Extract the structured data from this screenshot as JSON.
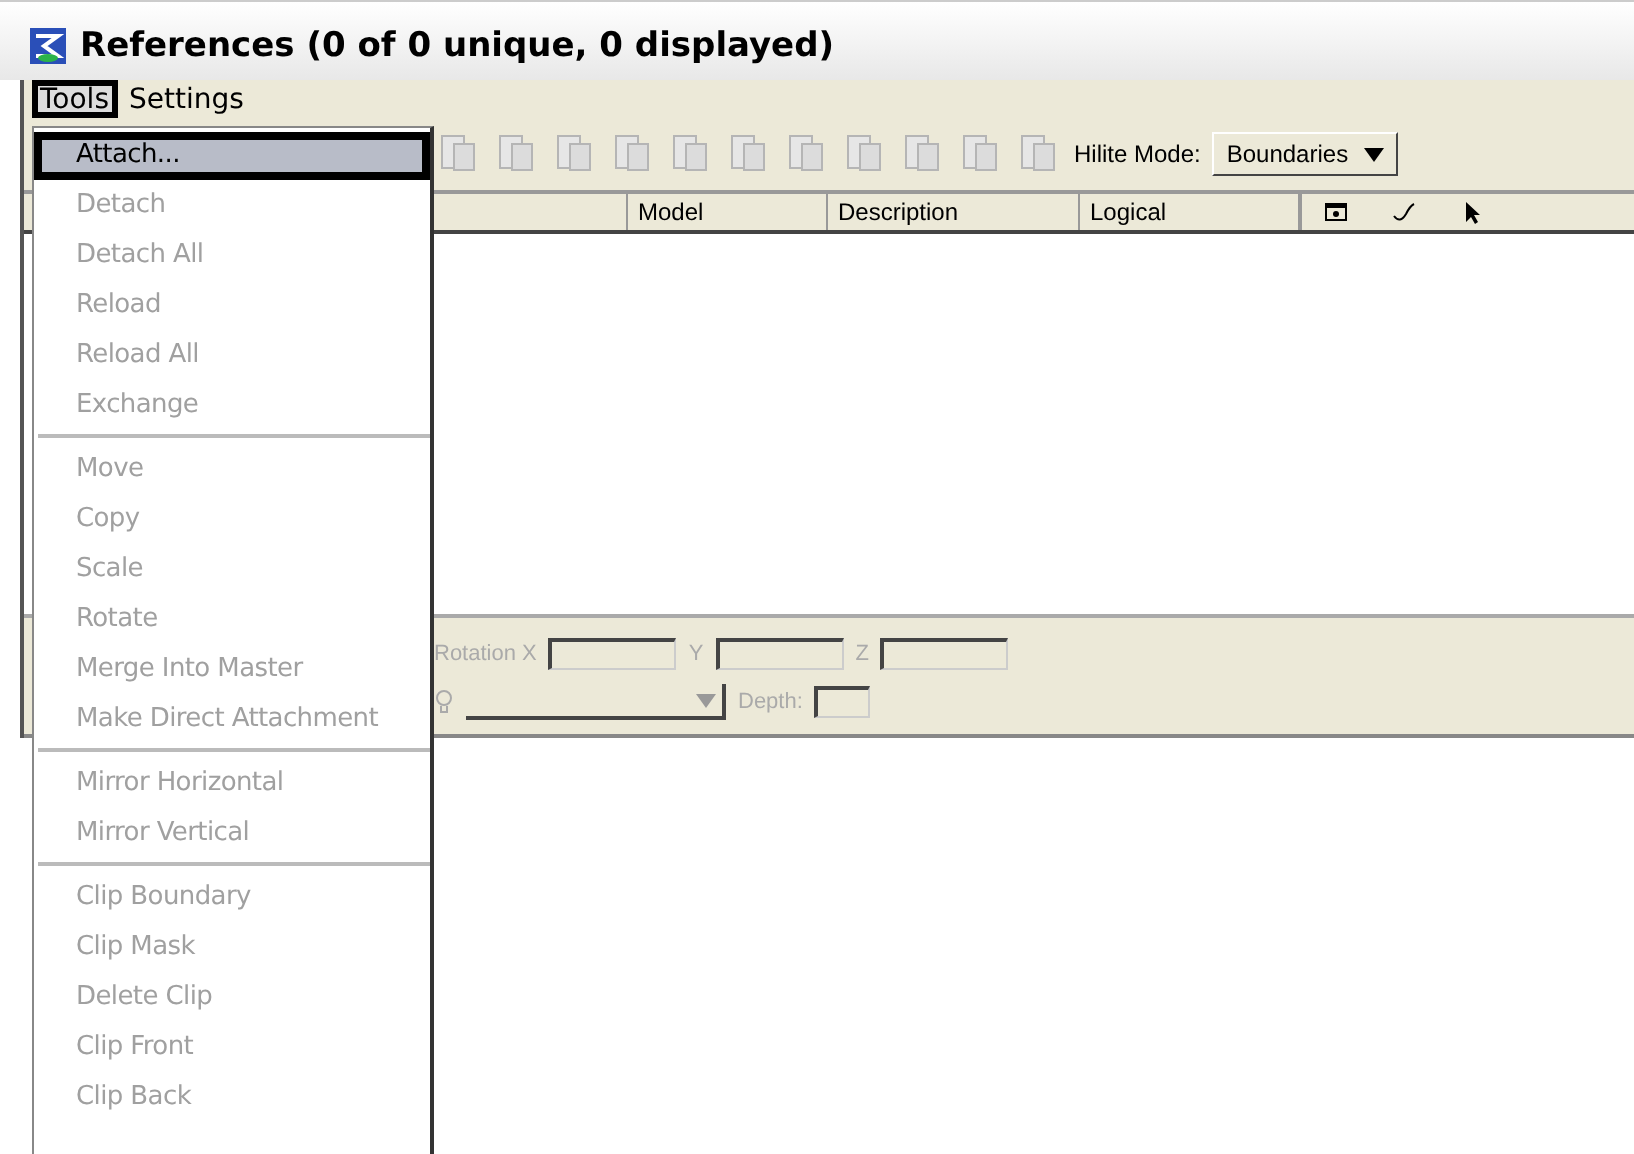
{
  "window": {
    "title": "References (0 of 0 unique, 0 displayed)"
  },
  "menu_bar": [
    {
      "label": "Tools",
      "selected": true
    },
    {
      "label": "Settings",
      "selected": false
    }
  ],
  "tools_menu": [
    {
      "kind": "item",
      "label": "Attach...",
      "disabled": false,
      "selected": true
    },
    {
      "kind": "item",
      "label": "Detach",
      "disabled": true,
      "selected": false
    },
    {
      "kind": "item",
      "label": "Detach All",
      "disabled": true,
      "selected": false
    },
    {
      "kind": "item",
      "label": "Reload",
      "disabled": true,
      "selected": false
    },
    {
      "kind": "item",
      "label": "Reload All",
      "disabled": true,
      "selected": false
    },
    {
      "kind": "item",
      "label": "Exchange",
      "disabled": true,
      "selected": false
    },
    {
      "kind": "separator"
    },
    {
      "kind": "item",
      "label": "Move",
      "disabled": true,
      "selected": false
    },
    {
      "kind": "item",
      "label": "Copy",
      "disabled": true,
      "selected": false
    },
    {
      "kind": "item",
      "label": "Scale",
      "disabled": true,
      "selected": false
    },
    {
      "kind": "item",
      "label": "Rotate",
      "disabled": true,
      "selected": false
    },
    {
      "kind": "item",
      "label": "Merge Into Master",
      "disabled": true,
      "selected": false
    },
    {
      "kind": "item",
      "label": "Make Direct Attachment",
      "disabled": true,
      "selected": false
    },
    {
      "kind": "separator"
    },
    {
      "kind": "item",
      "label": "Mirror Horizontal",
      "disabled": true,
      "selected": false
    },
    {
      "kind": "item",
      "label": "Mirror Vertical",
      "disabled": true,
      "selected": false
    },
    {
      "kind": "separator"
    },
    {
      "kind": "item",
      "label": "Clip Boundary",
      "disabled": true,
      "selected": false
    },
    {
      "kind": "item",
      "label": "Clip Mask",
      "disabled": true,
      "selected": false
    },
    {
      "kind": "item",
      "label": "Delete Clip",
      "disabled": true,
      "selected": false
    },
    {
      "kind": "item",
      "label": "Clip Front",
      "disabled": true,
      "selected": false
    },
    {
      "kind": "item",
      "label": "Clip Back",
      "disabled": true,
      "selected": false
    }
  ],
  "toolbar": {
    "hilite_mode": {
      "label": "Hilite Mode:",
      "value": "Boundaries"
    }
  },
  "table": {
    "columns": [
      "Model",
      "Description",
      "Logical"
    ]
  },
  "details": {
    "rotation_label": "Rotation X",
    "y_label": "Y",
    "z_label": "Z",
    "depth_label": "Depth:"
  }
}
